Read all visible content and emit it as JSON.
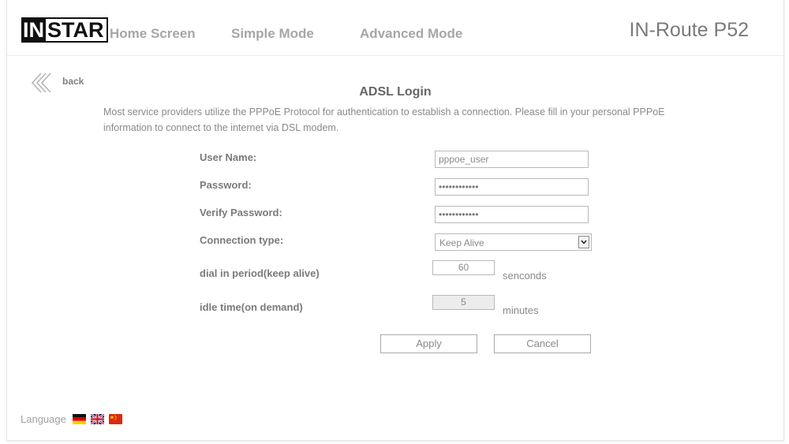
{
  "header": {
    "logo": {
      "part1": "IN",
      "part2": "STAR"
    },
    "nav": [
      "Home Screen",
      "Simple Mode",
      "Advanced Mode"
    ],
    "product": "IN-Route P52"
  },
  "back": {
    "label": "back",
    "icon": "double-chevron-left-icon"
  },
  "page": {
    "title": "ADSL Login",
    "description": "Most service providers utilize the PPPoE Protocol for authentication to establish a connection. Please fill in your personal PPPoE information to connect to the internet via DSL modem."
  },
  "form": {
    "user_name_label": "User Name:",
    "user_name_value": "pppoe_user",
    "password_label": "Password:",
    "password_value": "••••••••••••",
    "verify_label": "Verify Password:",
    "verify_value": "••••••••••••",
    "connection_type_label": "Connection type:",
    "connection_type_value": "Keep Alive",
    "dial_label": "dial in period(keep alive)",
    "dial_value": "60",
    "dial_unit": "senconds",
    "idle_label": "idle time(on demand)",
    "idle_value": "5",
    "idle_unit": "minutes"
  },
  "buttons": {
    "apply": "Apply",
    "cancel": "Cancel"
  },
  "footer": {
    "language_label": "Language",
    "flags": [
      "german-flag-icon",
      "uk-flag-icon",
      "china-flag-icon"
    ]
  }
}
